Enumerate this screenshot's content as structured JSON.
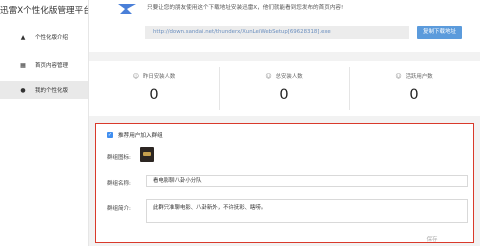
{
  "app_title": "迅雷X个性化版管理平台",
  "sidebar": {
    "items": [
      {
        "label": "个性化版介绍",
        "icon": "home-icon",
        "active": false
      },
      {
        "label": "首页内容管理",
        "icon": "grid-icon",
        "active": false
      },
      {
        "label": "我的个性化版",
        "icon": "user-icon",
        "active": true
      }
    ]
  },
  "top": {
    "message": "只要让您的朋友使用这个下载地址安装迅雷X，他们就能看到您发布的首页内容!",
    "download_url": "http://down.sandai.net/thunderx/XunLeiWebSetup[69628318].exe",
    "copy_button": "复制下载地址"
  },
  "stats": [
    {
      "label": "昨日安装人数",
      "icon": "person-add-icon",
      "value": "0"
    },
    {
      "label": "总安装人数",
      "icon": "person-icon",
      "value": "0"
    },
    {
      "label": "活跃用户数",
      "icon": "user-active-icon",
      "value": "0"
    }
  ],
  "group_settings": {
    "recommend_checkbox_label": "推荐用户加入群组",
    "recommend_checked": true,
    "icon_label": "群组图标:",
    "name_label": "群组名称:",
    "name_value": "看电影聊八卦小分队",
    "intro_label": "群组简介:",
    "intro_value": "此群只准聊电影、八卦新外，不许抚彩、瞎唠。",
    "save_button": "保存"
  },
  "colors": {
    "accent": "#5b9bdc",
    "highlight_border": "#d93a2b",
    "checkbox": "#3f8ef0"
  }
}
